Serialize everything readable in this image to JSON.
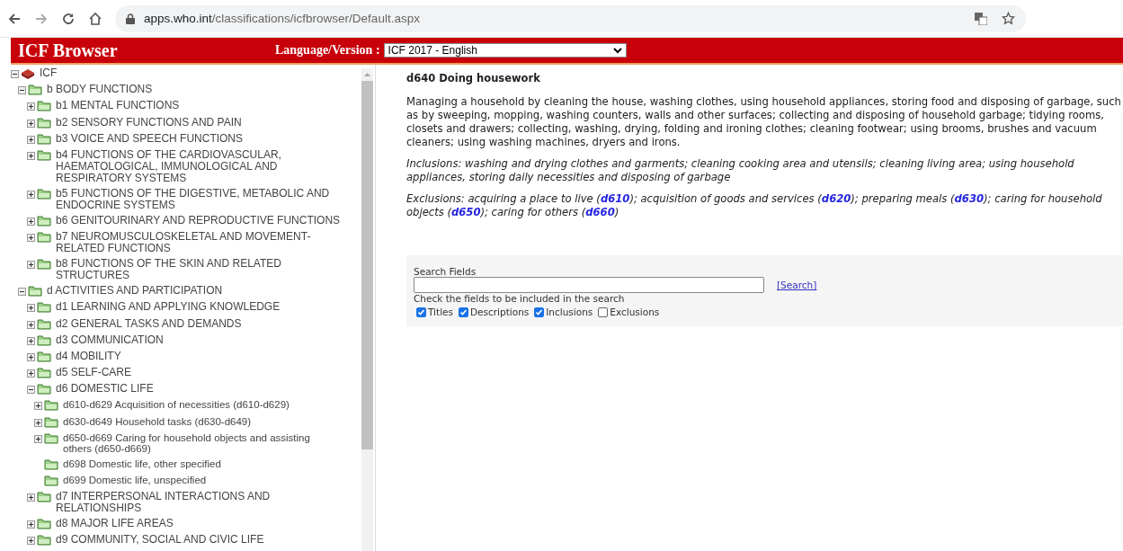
{
  "browser": {
    "url_host": "apps.who.int",
    "url_path": "/classifications/icfbrowser/Default.aspx"
  },
  "header": {
    "title": "ICF Browser",
    "language_label": "Language/Version :",
    "language_value": "ICF 2017 - English"
  },
  "tree": [
    {
      "label": "ICF",
      "kind": "book",
      "expanded": true,
      "children": [
        {
          "label": "b BODY FUNCTIONS",
          "kind": "folder",
          "expanded": true,
          "children": [
            {
              "label": "b1 MENTAL FUNCTIONS",
              "kind": "folder",
              "expanded": false
            },
            {
              "label": "b2 SENSORY FUNCTIONS AND PAIN",
              "kind": "folder",
              "expanded": false
            },
            {
              "label": "b3 VOICE AND SPEECH FUNCTIONS",
              "kind": "folder",
              "expanded": false
            },
            {
              "label": "b4 FUNCTIONS OF THE CARDIOVASCULAR, HAEMATOLOGICAL, IMMUNOLOGICAL AND RESPIRATORY SYSTEMS",
              "kind": "folder",
              "expanded": false
            },
            {
              "label": "b5 FUNCTIONS OF THE DIGESTIVE, METABOLIC AND ENDOCRINE SYSTEMS",
              "kind": "folder",
              "expanded": false
            },
            {
              "label": "b6 GENITOURINARY AND REPRODUCTIVE FUNCTIONS",
              "kind": "folder",
              "expanded": false
            },
            {
              "label": "b7 NEUROMUSCULOSKELETAL AND MOVEMENT-RELATED FUNCTIONS",
              "kind": "folder",
              "expanded": false
            },
            {
              "label": "b8 FUNCTIONS OF THE SKIN AND RELATED STRUCTURES",
              "kind": "folder",
              "expanded": false
            }
          ]
        },
        {
          "label": "d ACTIVITIES AND PARTICIPATION",
          "kind": "folder",
          "expanded": true,
          "children": [
            {
              "label": "d1 LEARNING AND APPLYING KNOWLEDGE",
              "kind": "folder",
              "expanded": false
            },
            {
              "label": "d2 GENERAL TASKS AND DEMANDS",
              "kind": "folder",
              "expanded": false
            },
            {
              "label": "d3 COMMUNICATION",
              "kind": "folder",
              "expanded": false
            },
            {
              "label": "d4 MOBILITY",
              "kind": "folder",
              "expanded": false
            },
            {
              "label": "d5 SELF-CARE",
              "kind": "folder",
              "expanded": false
            },
            {
              "label": "d6 DOMESTIC LIFE",
              "kind": "folder",
              "expanded": true,
              "children": [
                {
                  "label": "d610-d629 Acquisition of necessities (d610-d629)",
                  "kind": "folder",
                  "expanded": false
                },
                {
                  "label": "d630-d649 Household tasks (d630-d649)",
                  "kind": "folder",
                  "expanded": false
                },
                {
                  "label": "d650-d669 Caring for household objects and assisting others (d650-d669)",
                  "kind": "folder",
                  "expanded": false
                },
                {
                  "label": "d698 Domestic life, other specified",
                  "kind": "leaf"
                },
                {
                  "label": "d699 Domestic life, unspecified",
                  "kind": "leaf"
                }
              ]
            },
            {
              "label": "d7 INTERPERSONAL INTERACTIONS AND RELATIONSHIPS",
              "kind": "folder",
              "expanded": false
            },
            {
              "label": "d8 MAJOR LIFE AREAS",
              "kind": "folder",
              "expanded": false
            },
            {
              "label": "d9 COMMUNITY, SOCIAL AND CIVIC LIFE",
              "kind": "folder",
              "expanded": false
            }
          ]
        }
      ]
    }
  ],
  "detail": {
    "title": "d640 Doing housework",
    "description": "Managing a household by cleaning the house, washing clothes, using household appliances, storing food and disposing of garbage, such as by sweeping, mopping, washing counters, walls and other surfaces; collecting and disposing of household garbage; tidying rooms, closets and drawers; collecting, washing, drying, folding and ironing clothes; cleaning footwear; using brooms, brushes and vacuum cleaners; using washing machines, dryers and irons.",
    "inclusions": "Inclusions: washing and drying clothes and garments; cleaning cooking area and utensils; cleaning living area; using household appliances, storing daily necessities and disposing of garbage",
    "exclusions": [
      {
        "kind": "text",
        "text": "Exclusions: acquiring a place to live ("
      },
      {
        "kind": "link",
        "text": "d610"
      },
      {
        "kind": "text",
        "text": "); acquisition of goods and services ("
      },
      {
        "kind": "link",
        "text": "d620"
      },
      {
        "kind": "text",
        "text": "); preparing meals ("
      },
      {
        "kind": "link",
        "text": "d630"
      },
      {
        "kind": "text",
        "text": "); caring for household objects ("
      },
      {
        "kind": "link",
        "text": "d650"
      },
      {
        "kind": "text",
        "text": "); caring for others ("
      },
      {
        "kind": "link",
        "text": "d660"
      },
      {
        "kind": "text",
        "text": ")"
      }
    ]
  },
  "search": {
    "label": "Search Fields",
    "button": "[Search]",
    "hint": "Check the fields to be included in the search",
    "fields": [
      {
        "label": "Titles",
        "checked": true
      },
      {
        "label": "Descriptions",
        "checked": true
      },
      {
        "label": "Inclusions",
        "checked": true
      },
      {
        "label": "Exclusions",
        "checked": false
      }
    ]
  }
}
